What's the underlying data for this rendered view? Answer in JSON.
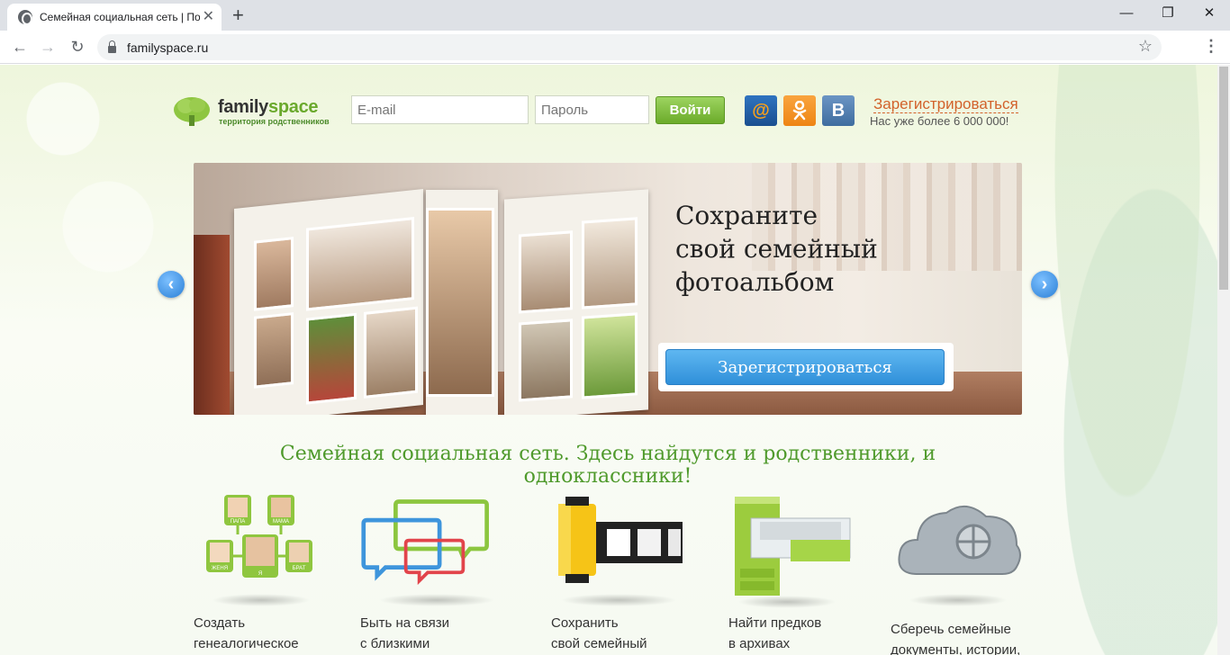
{
  "browser": {
    "tab_title": "Семейная социальная сеть | По",
    "tab_close": "✕",
    "new_tab": "+",
    "url": "familyspace.ru",
    "window_controls": [
      "—",
      "❐",
      "✕"
    ]
  },
  "header": {
    "logo_family": "family",
    "logo_space": "space",
    "logo_tagline": "территория родственников",
    "email_placeholder": "E-mail",
    "password_placeholder": "Пароль",
    "login_label": "Войти",
    "social": [
      {
        "icon": "mailru-icon",
        "glyph": "@",
        "color": "#1f5c9e"
      },
      {
        "icon": "odnoklassniki-icon",
        "glyph": "ok",
        "color": "#f28c1e"
      },
      {
        "icon": "vkontakte-icon",
        "glyph": "B",
        "color": "#4a76a8"
      }
    ],
    "register_link": "Зарегистрироваться",
    "members_text": "Нас уже более 6 000 000!"
  },
  "banner": {
    "title": "Сохраните свой семейный фотоальбом",
    "title_lines": [
      "Сохраните",
      "свой семейный",
      "фотоальбом"
    ],
    "cta_label": "Зарегистрироваться",
    "prev_glyph": "‹",
    "next_glyph": "›"
  },
  "tagline": "Семейная социальная сеть. Здесь найдутся и родственники, и одноклассники!",
  "tree_labels": [
    "ПАПА",
    "МАМА",
    "ЖЕНЯ",
    "Я",
    "БРАТ"
  ],
  "features": [
    {
      "icon": "family-tree-icon",
      "lines": [
        "Создать",
        "генеалогическое"
      ]
    },
    {
      "icon": "chat-bubbles-icon",
      "lines": [
        "Быть на связи",
        "с близкими"
      ]
    },
    {
      "icon": "film-roll-icon",
      "lines": [
        "Сохранить",
        "свой семейный"
      ]
    },
    {
      "icon": "archive-cabinet-icon",
      "lines": [
        "Найти предков",
        "в архивах"
      ]
    },
    {
      "icon": "cloud-safe-icon",
      "lines": [
        "Сберечь семейные",
        "документы, истории,"
      ]
    }
  ]
}
